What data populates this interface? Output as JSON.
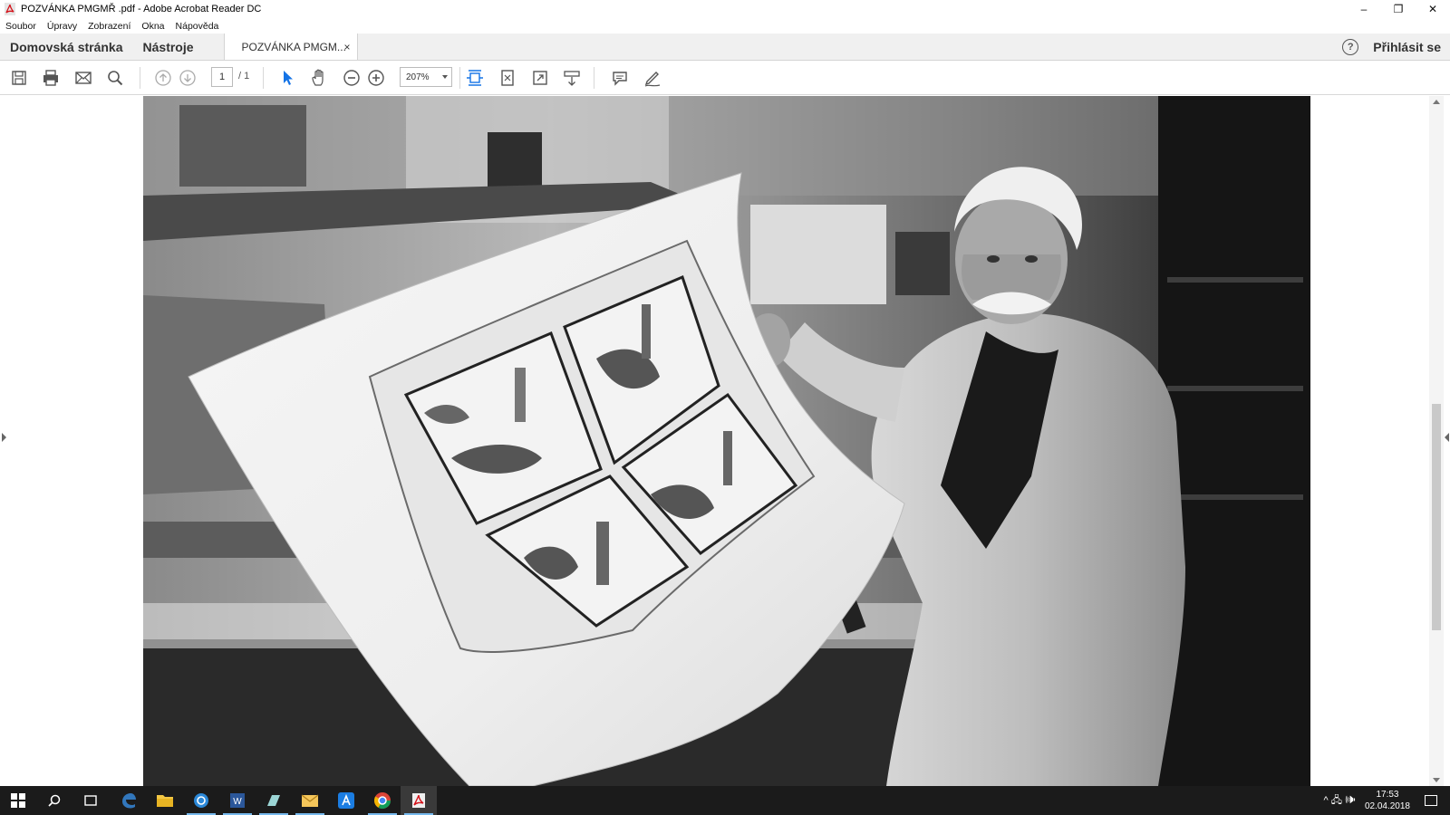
{
  "window": {
    "title": "POZVÁNKA PMGMŘ .pdf - Adobe Acrobat Reader DC",
    "controls": {
      "minimize": "–",
      "maximize": "❐",
      "close": "✕"
    }
  },
  "menu": [
    "Soubor",
    "Úpravy",
    "Zobrazení",
    "Okna",
    "Nápověda"
  ],
  "tabs": {
    "home": "Domovská stránka",
    "tools": "Nástroje",
    "document": "POZVÁNKA PMGM...",
    "close_glyph": "×",
    "help_glyph": "?",
    "signin": "Přihlásit se"
  },
  "toolbar": {
    "icons": [
      "save-icon",
      "print-icon",
      "email-icon",
      "search-icon",
      "prev-page-icon",
      "next-page-icon",
      "select-tool-icon",
      "hand-tool-icon",
      "zoom-out-icon",
      "zoom-in-icon",
      "fit-width-icon",
      "fit-page-icon",
      "full-screen-icon",
      "scroll-mode-icon",
      "comment-icon",
      "sign-icon"
    ],
    "page_current": "1",
    "page_total": "/ 1",
    "zoom": "207%"
  },
  "document": {
    "content": "black-and-white photograph of an artist holding a large print"
  },
  "taskbar": {
    "apps": [
      "windows-start-icon",
      "search-icon",
      "task-view-icon",
      "edge-icon",
      "file-explorer-icon",
      "app-icon",
      "word-icon",
      "app-icon-2",
      "mail-icon",
      "app-store-icon",
      "chrome-icon",
      "acrobat-icon"
    ],
    "tray_glyphs": "^ 🖧 🕪",
    "time": "17:53",
    "date": "02.04.2018"
  },
  "colors": {
    "accent_blue": "#1473e6",
    "taskbar": "#1b1b1b",
    "tab_bg": "#f0f0f0"
  }
}
